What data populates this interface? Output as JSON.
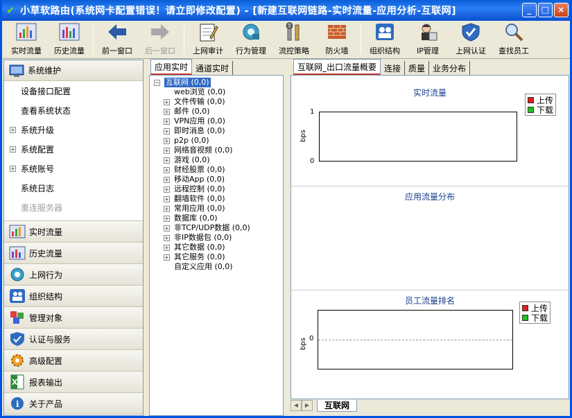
{
  "window": {
    "title": "小草软路由(系统网卡配置错误！请立即修改配置) - [新建互联网链路-实时流量-应用分析-互联网]",
    "buttons": [
      "_",
      "□",
      "×"
    ]
  },
  "toolbar": {
    "items": [
      {
        "label": "实时流量",
        "icon": "realtime-traffic-icon",
        "enabled": true
      },
      {
        "label": "历史流量",
        "icon": "history-traffic-icon",
        "enabled": true
      },
      {
        "label": "前一窗口",
        "icon": "back-arrow-icon",
        "enabled": true
      },
      {
        "label": "后一窗口",
        "icon": "forward-arrow-icon",
        "enabled": false
      },
      {
        "label": "上网审计",
        "icon": "audit-notepad-icon",
        "enabled": true
      },
      {
        "label": "行为管理",
        "icon": "behavior-gear-icon",
        "enabled": true
      },
      {
        "label": "流控策略",
        "icon": "tools-icon",
        "enabled": true
      },
      {
        "label": "防火墙",
        "icon": "firewall-bricks-icon",
        "enabled": true
      },
      {
        "label": "组织结构",
        "icon": "org-users-icon",
        "enabled": true
      },
      {
        "label": "IP管理",
        "icon": "ip-person-icon",
        "enabled": true
      },
      {
        "label": "上网认证",
        "icon": "auth-shield-icon",
        "enabled": true
      },
      {
        "label": "查找员工",
        "icon": "magnifier-icon",
        "enabled": true
      }
    ]
  },
  "leftnav": {
    "header": "系统维护",
    "sub_items": [
      {
        "label": "设备接口配置",
        "expandable": false,
        "dim": false
      },
      {
        "label": "查看系统状态",
        "expandable": false,
        "dim": false
      },
      {
        "label": "系统升级",
        "expandable": true,
        "dim": false
      },
      {
        "label": "系统配置",
        "expandable": true,
        "dim": false
      },
      {
        "label": "系统账号",
        "expandable": true,
        "dim": false
      },
      {
        "label": "系统日志",
        "expandable": false,
        "dim": false
      },
      {
        "label": "重连服务器",
        "expandable": false,
        "dim": true
      }
    ],
    "groups": [
      {
        "label": "实时流量",
        "icon": "realtime-traffic-icon"
      },
      {
        "label": "历史流量",
        "icon": "history-traffic-icon"
      },
      {
        "label": "上网行为",
        "icon": "browsing-behavior-icon"
      },
      {
        "label": "组织结构",
        "icon": "org-users-icon"
      },
      {
        "label": "管理对象",
        "icon": "managed-objects-icon"
      },
      {
        "label": "认证与服务",
        "icon": "auth-shield-icon"
      },
      {
        "label": "高级配置",
        "icon": "advanced-gear-icon"
      },
      {
        "label": "报表输出",
        "icon": "excel-report-icon"
      },
      {
        "label": "关于产品",
        "icon": "info-icon"
      }
    ]
  },
  "midpane": {
    "tabs": [
      "应用实时",
      "通道实时"
    ],
    "active_tab": 0,
    "root": "互联网 (0,0)",
    "children": [
      {
        "label": "web浏览 (0,0)",
        "expandable": false
      },
      {
        "label": "文件传输 (0,0)",
        "expandable": true
      },
      {
        "label": "邮件 (0,0)",
        "expandable": true
      },
      {
        "label": "VPN应用 (0,0)",
        "expandable": true
      },
      {
        "label": "即时消息 (0,0)",
        "expandable": true
      },
      {
        "label": "p2p (0,0)",
        "expandable": true
      },
      {
        "label": "网络音视频 (0,0)",
        "expandable": true
      },
      {
        "label": "游戏 (0,0)",
        "expandable": true
      },
      {
        "label": "财经股票 (0,0)",
        "expandable": true
      },
      {
        "label": "移动App (0,0)",
        "expandable": true
      },
      {
        "label": "远程控制 (0,0)",
        "expandable": true
      },
      {
        "label": "翻墙软件 (0,0)",
        "expandable": true
      },
      {
        "label": "常用应用 (0,0)",
        "expandable": true
      },
      {
        "label": "数据库 (0,0)",
        "expandable": true
      },
      {
        "label": "非TCP/UDP数据 (0,0)",
        "expandable": true
      },
      {
        "label": "非IP数据包 (0,0)",
        "expandable": true
      },
      {
        "label": "其它数据 (0,0)",
        "expandable": true
      },
      {
        "label": "其它服务 (0,0)",
        "expandable": true
      },
      {
        "label": "自定义应用 (0,0)",
        "expandable": false
      }
    ]
  },
  "rightpane": {
    "tabs": [
      "互联网_出口流量概要",
      "连接",
      "质量",
      "业务分布"
    ],
    "active_tab": 0,
    "panels": {
      "realtime": {
        "title": "实时流量",
        "ylabel": "bps",
        "ticks": [
          "1",
          "0"
        ],
        "legend": [
          "上传",
          "下载"
        ]
      },
      "app_dist": {
        "title": "应用流量分布"
      },
      "ranking": {
        "title": "员工流量排名",
        "ylabel": "bps",
        "ticks": [
          "0"
        ],
        "legend": [
          "上传",
          "下载"
        ]
      }
    },
    "bottom_tab": "互联网"
  },
  "colors": {
    "upload": "#e02020",
    "download": "#20c020",
    "title_blue": "#0054e3",
    "highlight": "#316ac5"
  }
}
